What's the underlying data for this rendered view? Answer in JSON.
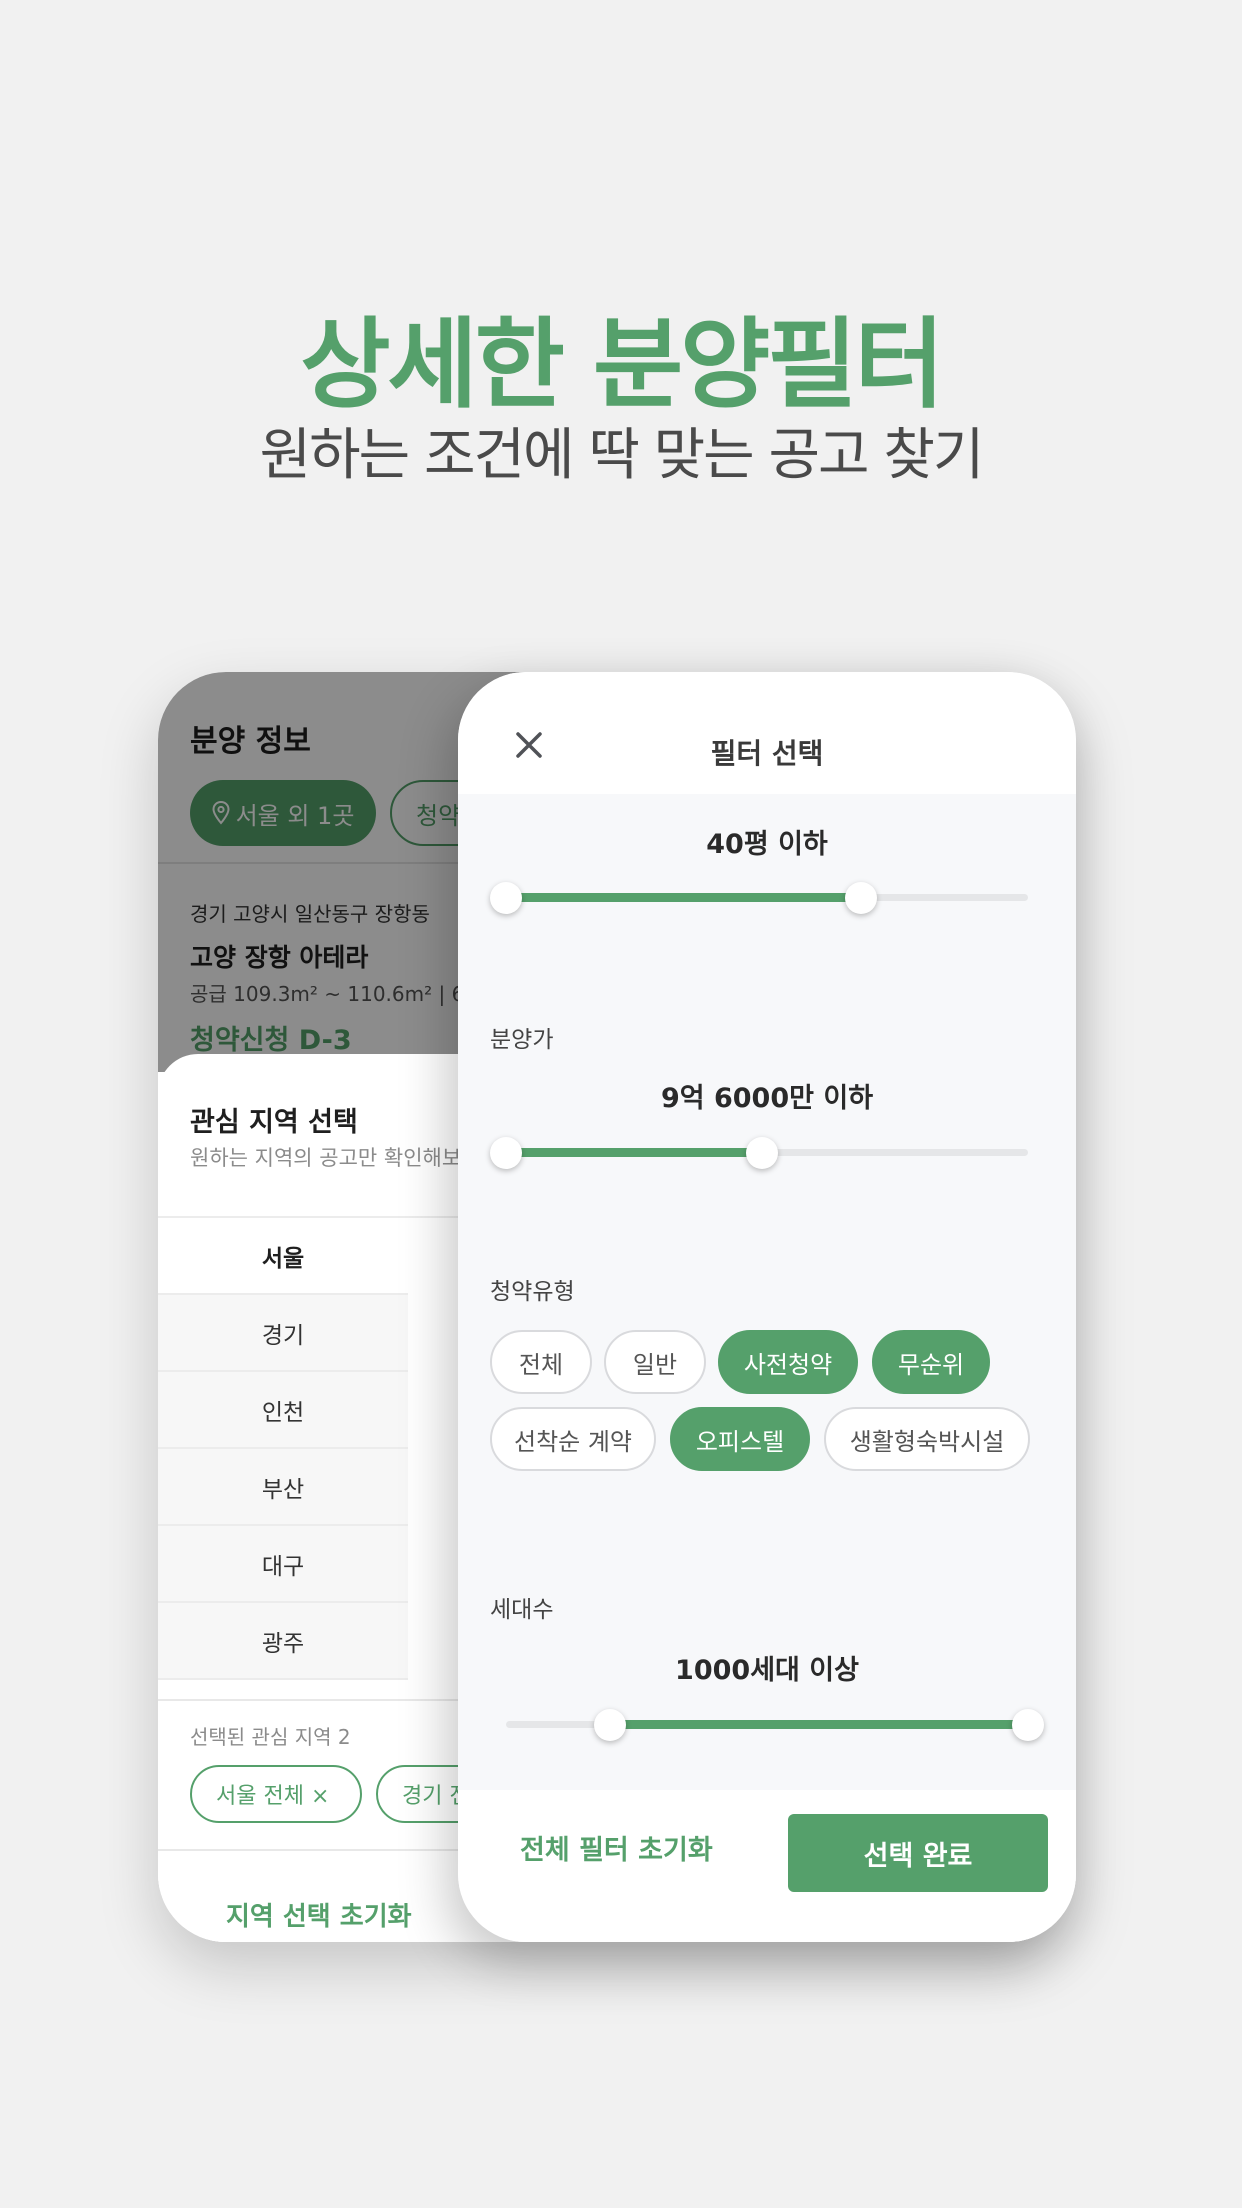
{
  "hero": {
    "title": "상세한 분양필터",
    "subtitle": "원하는 조건에 딱 맞는 공고 찾기"
  },
  "background_screen": {
    "header_title": "분양 정보",
    "location_chip": "서울 외 1곳",
    "second_chip": "청약",
    "listing": {
      "address": "경기 고양시 일산동구 장항동",
      "name": "고양 장항 아테라",
      "supply": "공급 109.3m² ~ 110.6m² | 6.",
      "dday": "청약신청 D-3"
    },
    "region_sheet": {
      "title": "관심 지역 선택",
      "description": "원하는 지역의 공고만 확인해보",
      "regions": [
        "서울",
        "경기",
        "인천",
        "부산",
        "대구",
        "광주"
      ],
      "selected_label": "선택된 관심 지역 2",
      "selected_chips": [
        "서울 전체 ×",
        "경기 전"
      ],
      "reset_label": "지역 선택 초기화"
    }
  },
  "filter_panel": {
    "title": "필터 선택",
    "area": {
      "value_text": "40평 이하",
      "range": [
        0,
        0.68
      ]
    },
    "price": {
      "label": "분양가",
      "value_text": "9억 6000만 이하",
      "range": [
        0,
        0.49
      ]
    },
    "type": {
      "label": "청약유형",
      "options": [
        {
          "label": "전체",
          "selected": false
        },
        {
          "label": "일반",
          "selected": false
        },
        {
          "label": "사전청약",
          "selected": true
        },
        {
          "label": "무순위",
          "selected": true
        },
        {
          "label": "선착순 계약",
          "selected": false
        },
        {
          "label": "오피스텔",
          "selected": true
        },
        {
          "label": "생활형숙박시설",
          "selected": false
        }
      ]
    },
    "households": {
      "label": "세대수",
      "value_text": "1000세대 이상",
      "range": [
        0.2,
        1.0
      ]
    },
    "reset_all_label": "전체 필터 초기화",
    "done_label": "선택 완료"
  },
  "colors": {
    "accent": "#55a06b",
    "background": "#f1f1f1"
  },
  "icons": [
    "close-icon",
    "location-pin-icon"
  ]
}
